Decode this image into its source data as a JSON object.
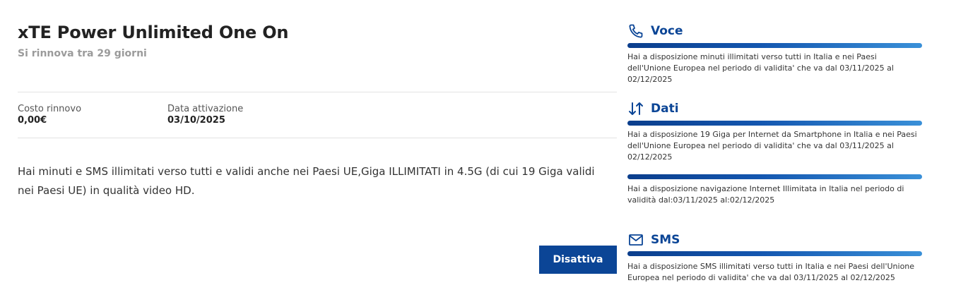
{
  "plan": {
    "title": "xTE Power Unlimited One On",
    "renew_text": "Si rinnova tra 29 giorni",
    "cost_label": "Costo rinnovo",
    "cost_value": "0,00€",
    "activation_label": "Data attivazione",
    "activation_value": "03/10/2025",
    "description": "Hai minuti e SMS illimitati verso tutti e validi anche nei Paesi UE,Giga ILLIMITATI in 4.5G (di cui 19 Giga validi nei Paesi UE) in qualità video HD.",
    "deactivate_label": "Disattiva"
  },
  "sections": {
    "voce": {
      "title": "Voce",
      "icon": "phone-icon",
      "text": "Hai a disposizione minuti illimitati verso tutti in Italia e nei Paesi dell'Unione Europea nel periodo di validita' che va dal 03/11/2025 al 02/12/2025"
    },
    "dati": {
      "title": "Dati",
      "icon": "data-transfer-icon",
      "text_1": "Hai a disposizione 19 Giga per Internet da Smartphone in Italia e nei Paesi dell'Unione Europea nel periodo di validita' che va dal 03/11/2025 al 02/12/2025",
      "text_2": "Hai a disposizione navigazione Internet Illimitata in Italia nel periodo di validità dal:03/11/2025 al:02/12/2025"
    },
    "sms": {
      "title": "SMS",
      "icon": "envelope-icon",
      "text": "Hai a disposizione SMS illimitati verso tutti in Italia e nei Paesi dell'Unione Europea nel periodo di validita' che va dal 03/11/2025 al 02/12/2025"
    }
  },
  "colors": {
    "brand_blue": "#0b4596",
    "muted_gray": "#9b9b9b"
  }
}
